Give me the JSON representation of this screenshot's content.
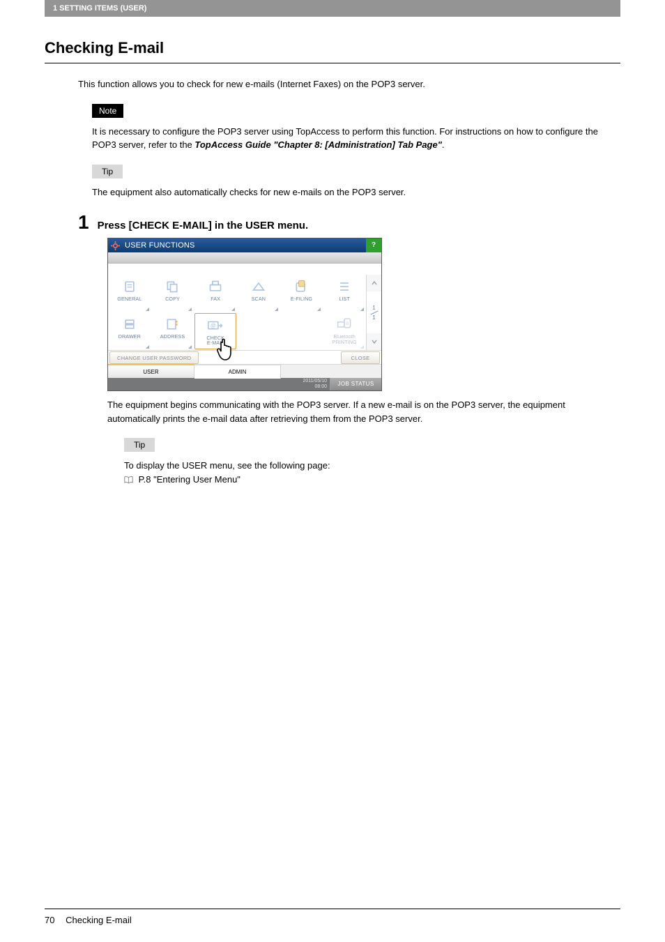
{
  "header": {
    "breadcrumb": "1 SETTING ITEMS (USER)"
  },
  "title": "Checking E-mail",
  "intro": "This function allows you to check for new e-mails (Internet Faxes) on the POP3 server.",
  "note": {
    "label": "Note",
    "text_a": "It is necessary to configure the POP3 server using TopAccess to perform this function. For instructions on how to configure the POP3 server, refer to the ",
    "ref": "TopAccess Guide \"Chapter 8: [Administration] Tab Page\"",
    "text_b": "."
  },
  "tip1": {
    "label": "Tip",
    "text": "The equipment also automatically checks for new e-mails on the POP3 server."
  },
  "step": {
    "num": "1",
    "heading": "Press [CHECK E-MAIL] in the USER menu."
  },
  "device": {
    "title": "USER FUNCTIONS",
    "help": "?",
    "tiles_row1": [
      {
        "label": "GENERAL"
      },
      {
        "label": "COPY"
      },
      {
        "label": "FAX"
      },
      {
        "label": "SCAN"
      },
      {
        "label": "E-FILING"
      },
      {
        "label": "LIST"
      }
    ],
    "tiles_row2": [
      {
        "label": "DRAWER"
      },
      {
        "label": "ADDRESS"
      },
      {
        "label": "CHECK\nE-MAIL"
      },
      {
        "label": ""
      },
      {
        "label": ""
      },
      {
        "label": "Bluetooth\nPRINTING"
      }
    ],
    "side": {
      "page_cur": "1",
      "page_total": "1"
    },
    "change_pw": "CHANGE USER PASSWORD",
    "close": "CLOSE",
    "tab_user": "USER",
    "tab_admin": "ADMIN",
    "timestamp_date": "2011/05/10",
    "timestamp_time": "08:00",
    "job_status": "JOB STATUS"
  },
  "step_body": {
    "text": "The equipment begins communicating with the POP3 server. If a new e-mail is on the POP3 server, the equipment automatically prints the e-mail data after retrieving them from the POP3 server."
  },
  "tip2": {
    "label": "Tip",
    "text": "To display the USER menu, see the following page:",
    "ref": "P.8 \"Entering User Menu\""
  },
  "footer": {
    "page_num": "70",
    "title": "Checking E-mail"
  }
}
